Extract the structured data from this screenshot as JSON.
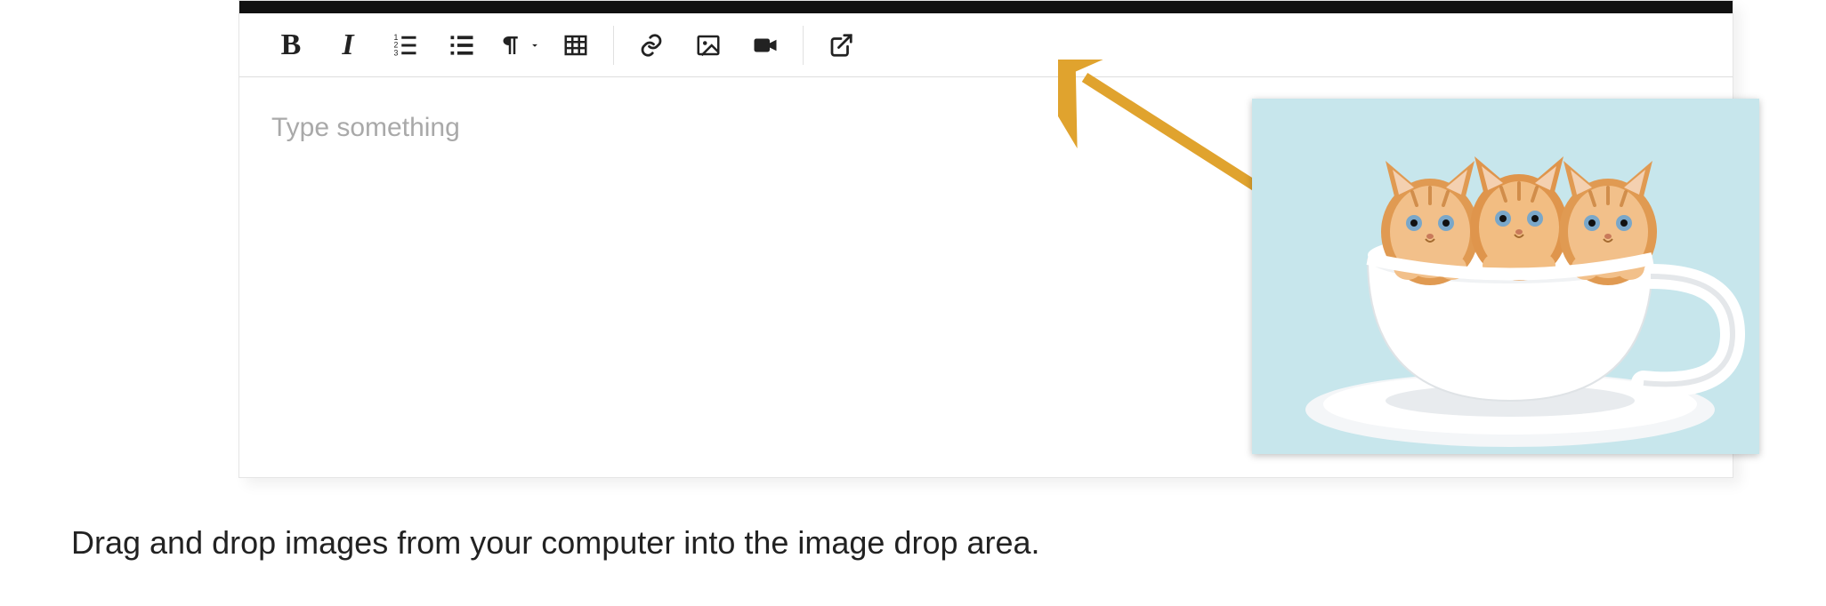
{
  "toolbar": {
    "bold_label": "B",
    "italic_label": "I",
    "ordered_list": "ordered-list",
    "unordered_list": "unordered-list",
    "paragraph": "paragraph-format",
    "table": "table",
    "link": "link",
    "image": "image",
    "video": "video",
    "popout": "popout"
  },
  "editor": {
    "placeholder": "Type something"
  },
  "annotation": {
    "arrow_target": "image-button"
  },
  "image_preview": {
    "alt": "Three orange kittens sitting in a white teacup on a saucer",
    "bg_color": "#c7e6ec"
  },
  "caption": "Drag and drop images from your computer into the image drop area."
}
